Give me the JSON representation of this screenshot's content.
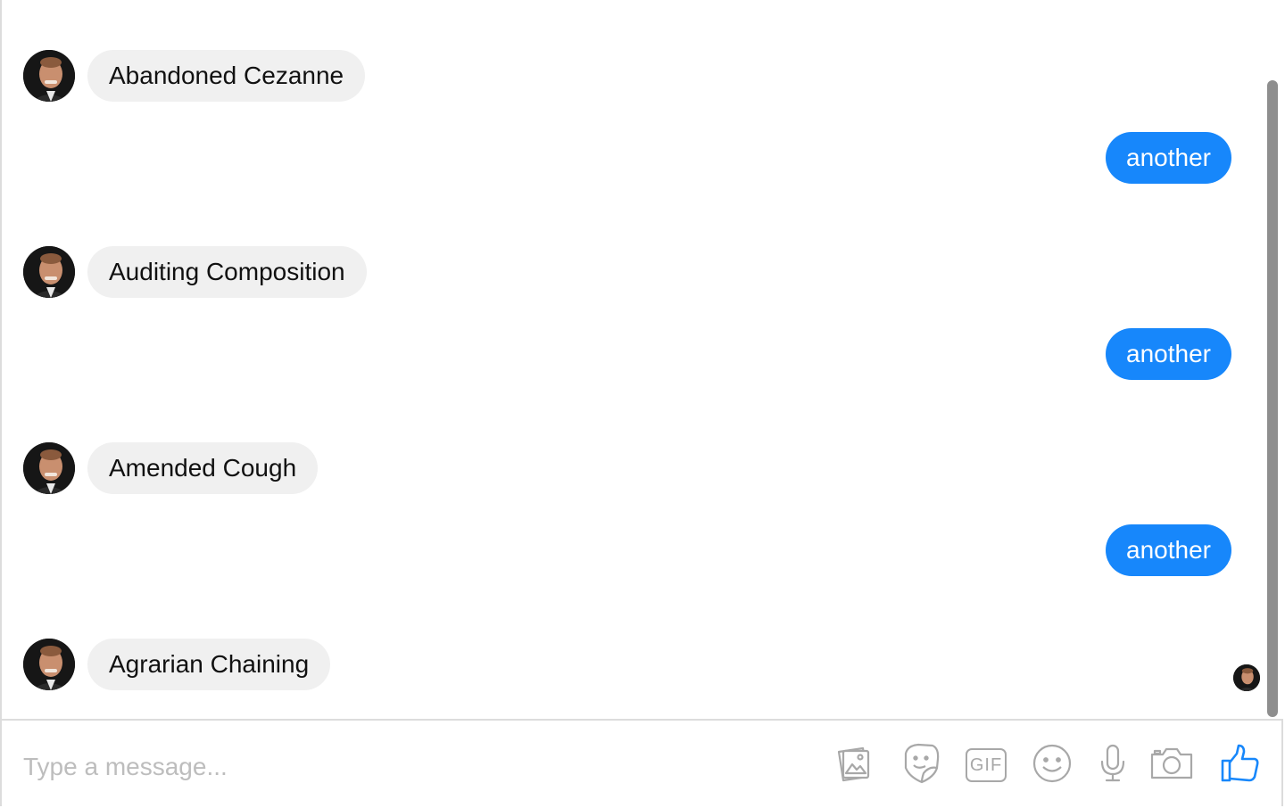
{
  "conversation": {
    "messages": [
      {
        "direction": "in",
        "text": "Abandoned Cezanne"
      },
      {
        "direction": "out",
        "text": "another"
      },
      {
        "direction": "in",
        "text": "Auditing Composition"
      },
      {
        "direction": "out",
        "text": "another"
      },
      {
        "direction": "in",
        "text": "Amended Cough"
      },
      {
        "direction": "out",
        "text": "another"
      },
      {
        "direction": "in",
        "text": "Agrarian Chaining"
      }
    ]
  },
  "composer": {
    "placeholder": "Type a message...",
    "value": "",
    "tools": [
      "photo-icon",
      "sticker-icon",
      "gif-icon",
      "emoji-icon",
      "microphone-icon",
      "camera-icon",
      "thumbs-up-icon"
    ],
    "gif_label": "GIF"
  },
  "colors": {
    "accent": "#1787fb",
    "incoming_bubble": "#f0f0f0",
    "icon_gray": "#a8a8a8"
  }
}
